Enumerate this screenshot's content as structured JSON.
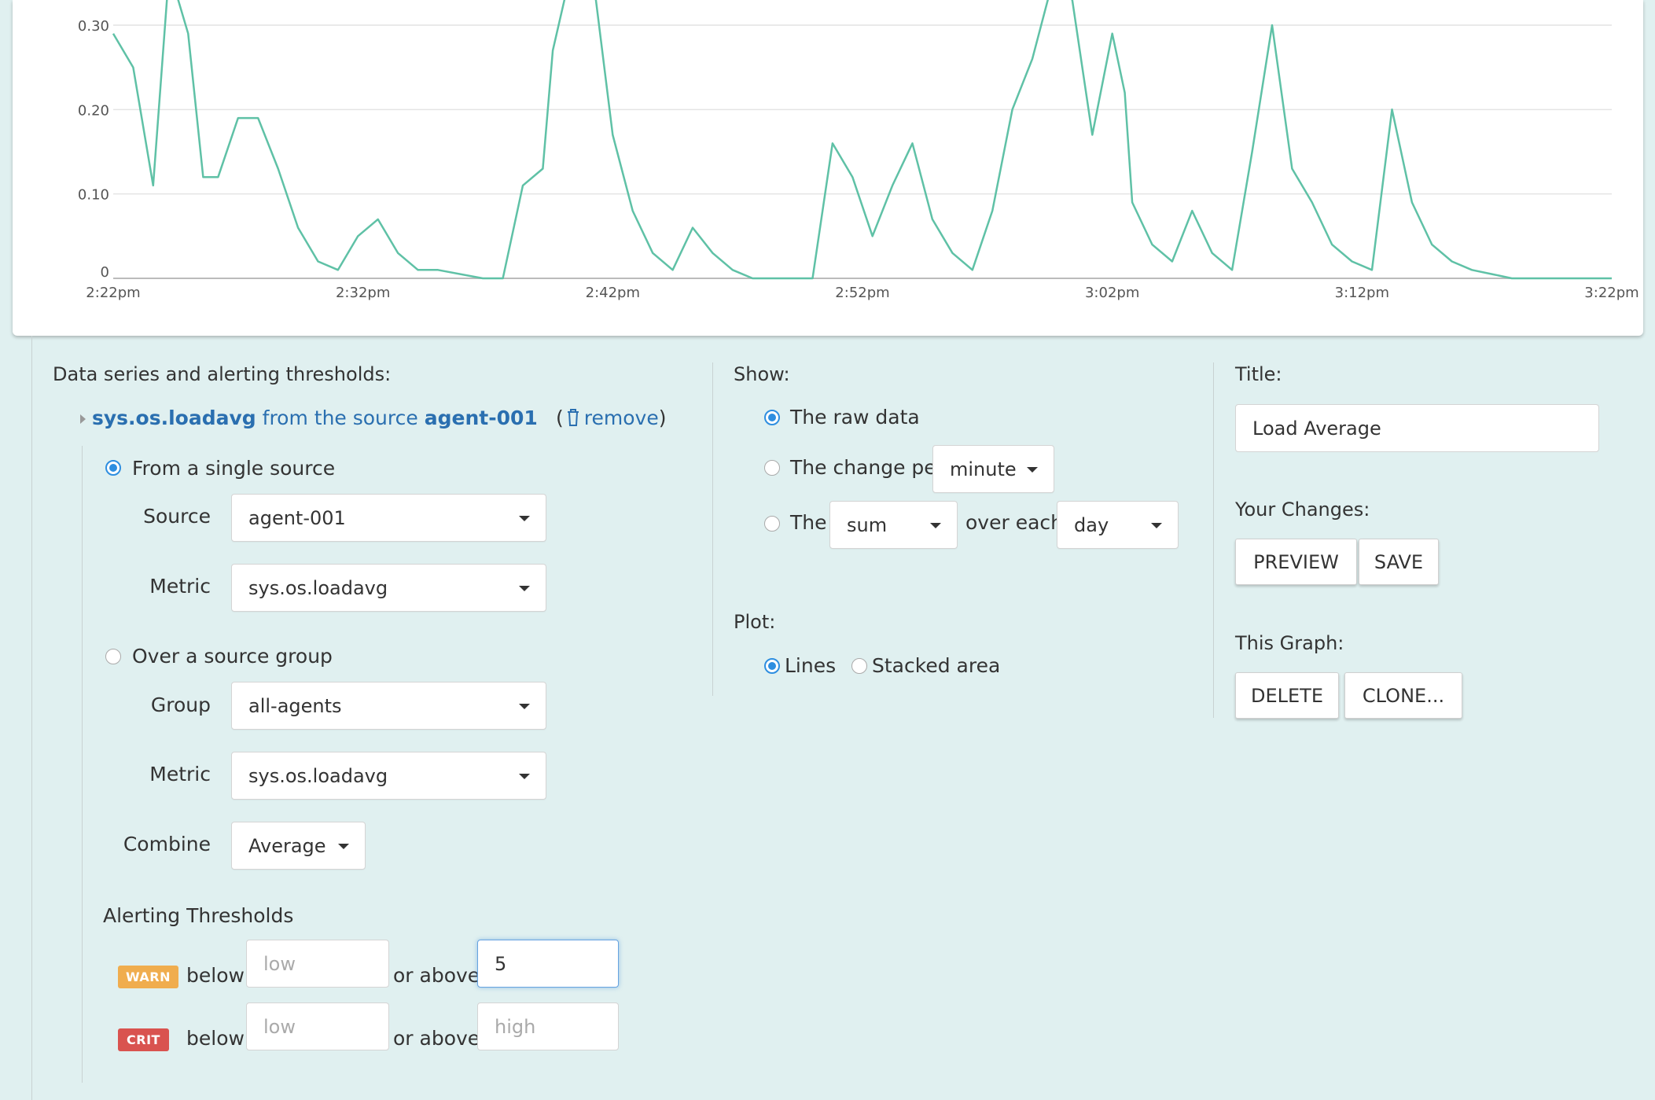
{
  "colors": {
    "line": "#5fc1a6",
    "background": "#e0f0f0",
    "link": "#2a6fb0",
    "radio_checked": "#2e8ee0",
    "warn": "#f0ad4e",
    "crit": "#d9534f"
  },
  "chart_data": {
    "type": "line",
    "xlabel": "",
    "ylabel": "",
    "x_ticks": [
      "2:22pm",
      "2:32pm",
      "2:42pm",
      "2:52pm",
      "3:02pm",
      "3:12pm",
      "3:22pm"
    ],
    "y_ticks": [
      "0",
      "0.10",
      "0.20",
      "0.30"
    ],
    "ylim": [
      0,
      0.33
    ],
    "x_range_minutes": [
      0,
      60
    ],
    "grid": true,
    "series": [
      {
        "x": [
          0,
          0.8,
          1.6,
          2.2,
          2.6,
          3.0,
          3.6,
          4.2,
          5.0,
          5.8,
          6.6,
          7.4,
          8.2,
          9.0,
          9.8,
          10.6,
          11.4,
          12.2,
          13.0,
          14.8,
          15.6,
          16.4,
          17.2,
          17.6,
          18.3,
          19.2,
          20.0,
          20.8,
          21.6,
          22.4,
          23.2,
          24.0,
          24.8,
          25.6,
          26.4,
          27.2,
          28.0,
          28.8,
          29.6,
          30.4,
          31.2,
          32.0,
          32.8,
          33.6,
          34.4,
          35.2,
          36.0,
          36.8,
          37.6,
          38.4,
          39.2,
          40.0,
          40.5,
          40.8,
          41.6,
          42.4,
          43.2,
          44.0,
          44.8,
          45.6,
          46.4,
          47.2,
          48.0,
          48.8,
          49.6,
          50.4,
          51.2,
          52.0,
          52.8,
          53.6,
          54.4,
          55.2,
          56.0,
          56.8,
          57.6,
          58.4,
          59.2,
          60.0
        ],
        "values": [
          0.29,
          0.25,
          0.11,
          0.35,
          0.33,
          0.29,
          0.12,
          0.12,
          0.19,
          0.19,
          0.13,
          0.06,
          0.02,
          0.01,
          0.05,
          0.07,
          0.03,
          0.01,
          0.01,
          0,
          0,
          0.11,
          0.13,
          0.27,
          0.36,
          0.36,
          0.17,
          0.08,
          0.03,
          0.01,
          0.06,
          0.03,
          0.01,
          0,
          0,
          0,
          0,
          0.16,
          0.12,
          0.05,
          0.11,
          0.16,
          0.07,
          0.03,
          0.01,
          0.08,
          0.2,
          0.26,
          0.35,
          0.33,
          0.17,
          0.29,
          0.22,
          0.09,
          0.04,
          0.02,
          0.08,
          0.03,
          0.01,
          0.15,
          0.3,
          0.13,
          0.09,
          0.04,
          0.02,
          0.01,
          0.2,
          0.09,
          0.04,
          0.02,
          0.01,
          0.005,
          0,
          0,
          0,
          0,
          0,
          0
        ]
      }
    ]
  },
  "data_series": {
    "heading": "Data series and alerting thresholds:",
    "metric_link": "sys.os.loadavg",
    "from_text": "from the source",
    "source_link": "agent-001",
    "remove_open": "(",
    "remove_label": "remove",
    "remove_close": ")",
    "single_source_label": "From a single source",
    "source_label": "Source",
    "source_value": "agent-001",
    "metric_label": "Metric",
    "metric_value": "sys.os.loadavg",
    "group_option_label": "Over a source group",
    "group_label": "Group",
    "group_value": "all-agents",
    "group_metric_label": "Metric",
    "group_metric_value": "sys.os.loadavg",
    "combine_label": "Combine",
    "combine_value": "Average"
  },
  "thresholds": {
    "heading": "Alerting Thresholds",
    "warn_badge": "WARN",
    "crit_badge": "CRIT",
    "below_label": "below",
    "or_above_label": "or above",
    "warn_low_placeholder": "low",
    "warn_high_value": "5",
    "crit_low_placeholder": "low",
    "crit_high_placeholder": "high"
  },
  "show": {
    "heading": "Show:",
    "raw_label": "The raw data",
    "change_label": "The change per",
    "change_value": "minute",
    "the_label": "The",
    "agg_value": "sum",
    "over_each_label": "over each",
    "period_value": "day"
  },
  "plot": {
    "heading": "Plot:",
    "lines_label": "Lines",
    "stacked_label": "Stacked area"
  },
  "right": {
    "title_heading": "Title:",
    "title_value": "Load Average",
    "changes_heading": "Your Changes:",
    "preview_label": "PREVIEW",
    "save_label": "SAVE",
    "graph_heading": "This Graph:",
    "delete_label": "DELETE",
    "clone_label": "CLONE..."
  }
}
